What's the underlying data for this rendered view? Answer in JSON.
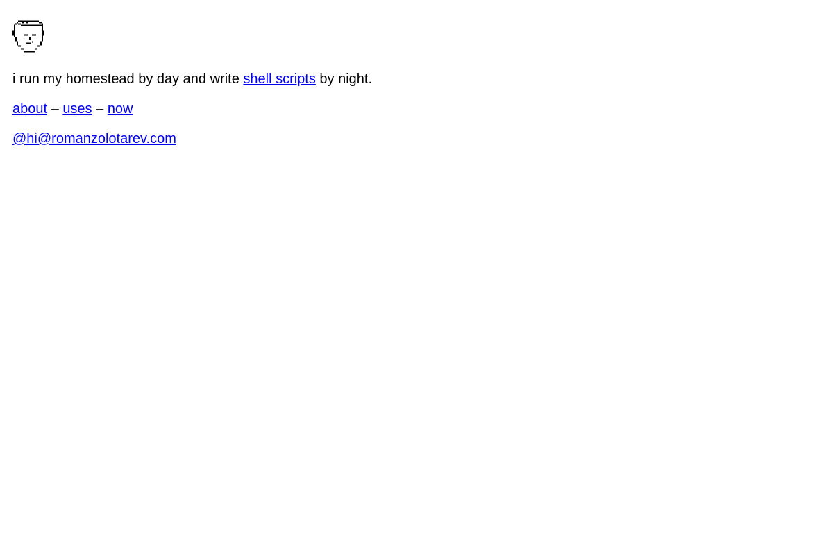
{
  "avatar": {
    "icon": "pixel-face-icon"
  },
  "intro": {
    "before": "i run my homestead by day and write ",
    "link": "shell scripts",
    "after": " by night."
  },
  "nav": {
    "items": [
      "about",
      "uses",
      "now"
    ],
    "separator": " – "
  },
  "contact": {
    "email": "@hi@romanzolotarev.com"
  },
  "colors": {
    "link": "#0000ee",
    "text": "#000000",
    "background": "#ffffff"
  }
}
